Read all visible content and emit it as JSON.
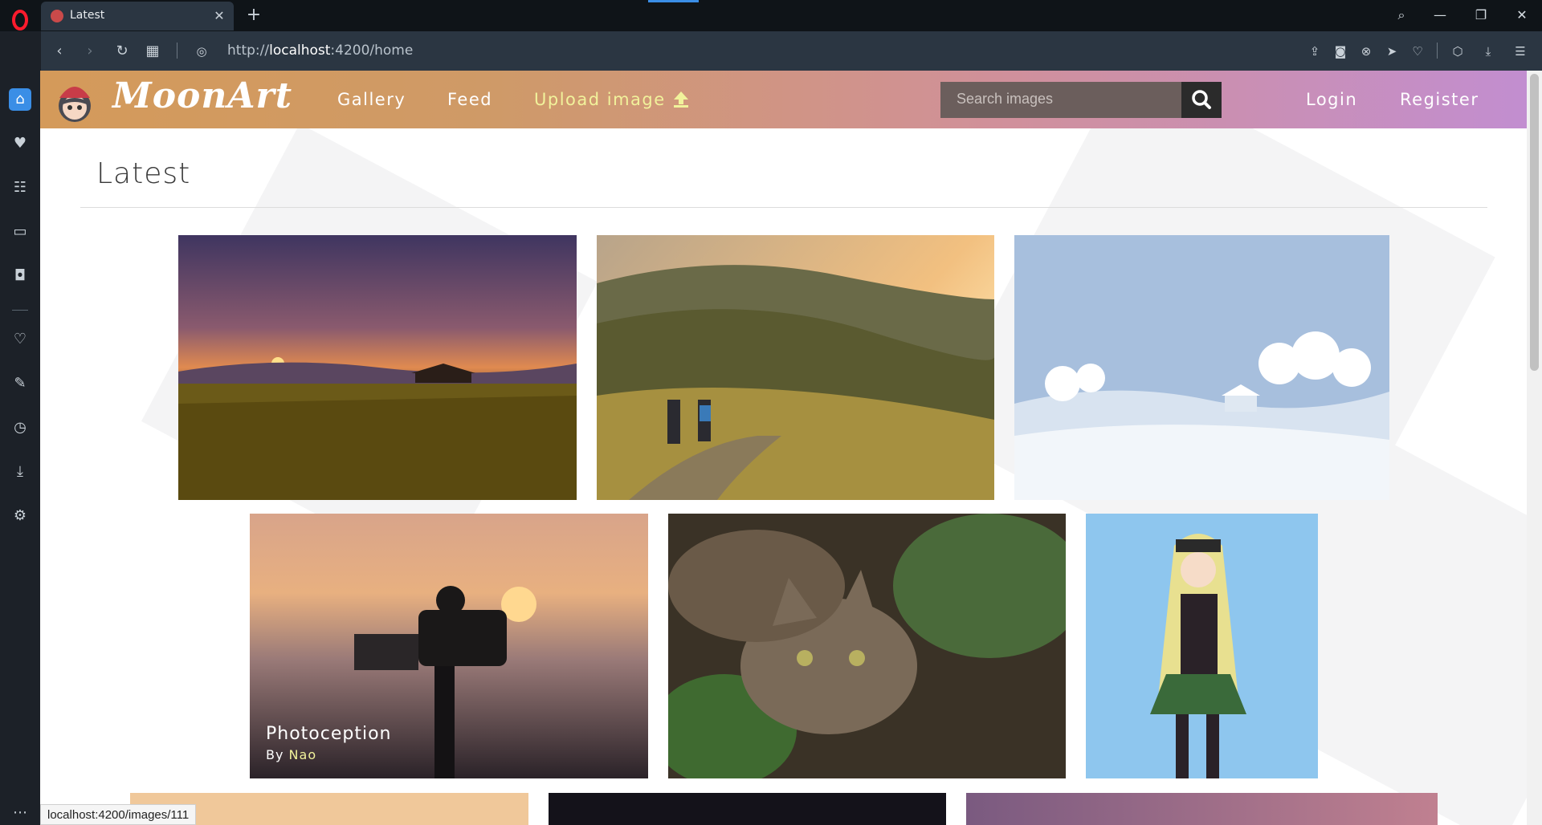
{
  "browser": {
    "tab_title": "Latest",
    "url_prefix": "http://",
    "url_host": "localhost",
    "url_path": ":4200/home",
    "new_tab_label": "+",
    "status_url": "localhost:4200/images/111"
  },
  "navbar": {
    "brand": "MoonArt",
    "links": [
      {
        "label": "Gallery"
      },
      {
        "label": "Feed"
      },
      {
        "label": "Upload image"
      }
    ],
    "search_placeholder": "Search images",
    "login_label": "Login",
    "register_label": "Register"
  },
  "page": {
    "heading": "Latest"
  },
  "images": [
    {
      "subject": "sunset-field"
    },
    {
      "subject": "hikers-mountains"
    },
    {
      "subject": "winter-landscape"
    },
    {
      "subject": "camera-sunset",
      "title": "Photoception",
      "by": "By",
      "author": "Nao"
    },
    {
      "subject": "tabby-cat"
    },
    {
      "subject": "anime-girl"
    },
    {
      "subject": "partial-1"
    },
    {
      "subject": "partial-2"
    },
    {
      "subject": "partial-3"
    }
  ],
  "colors": {
    "accent_blue": "#3a8ee6",
    "upload_yellow": "#f1f29b",
    "opera_red": "#ff1b2d"
  }
}
